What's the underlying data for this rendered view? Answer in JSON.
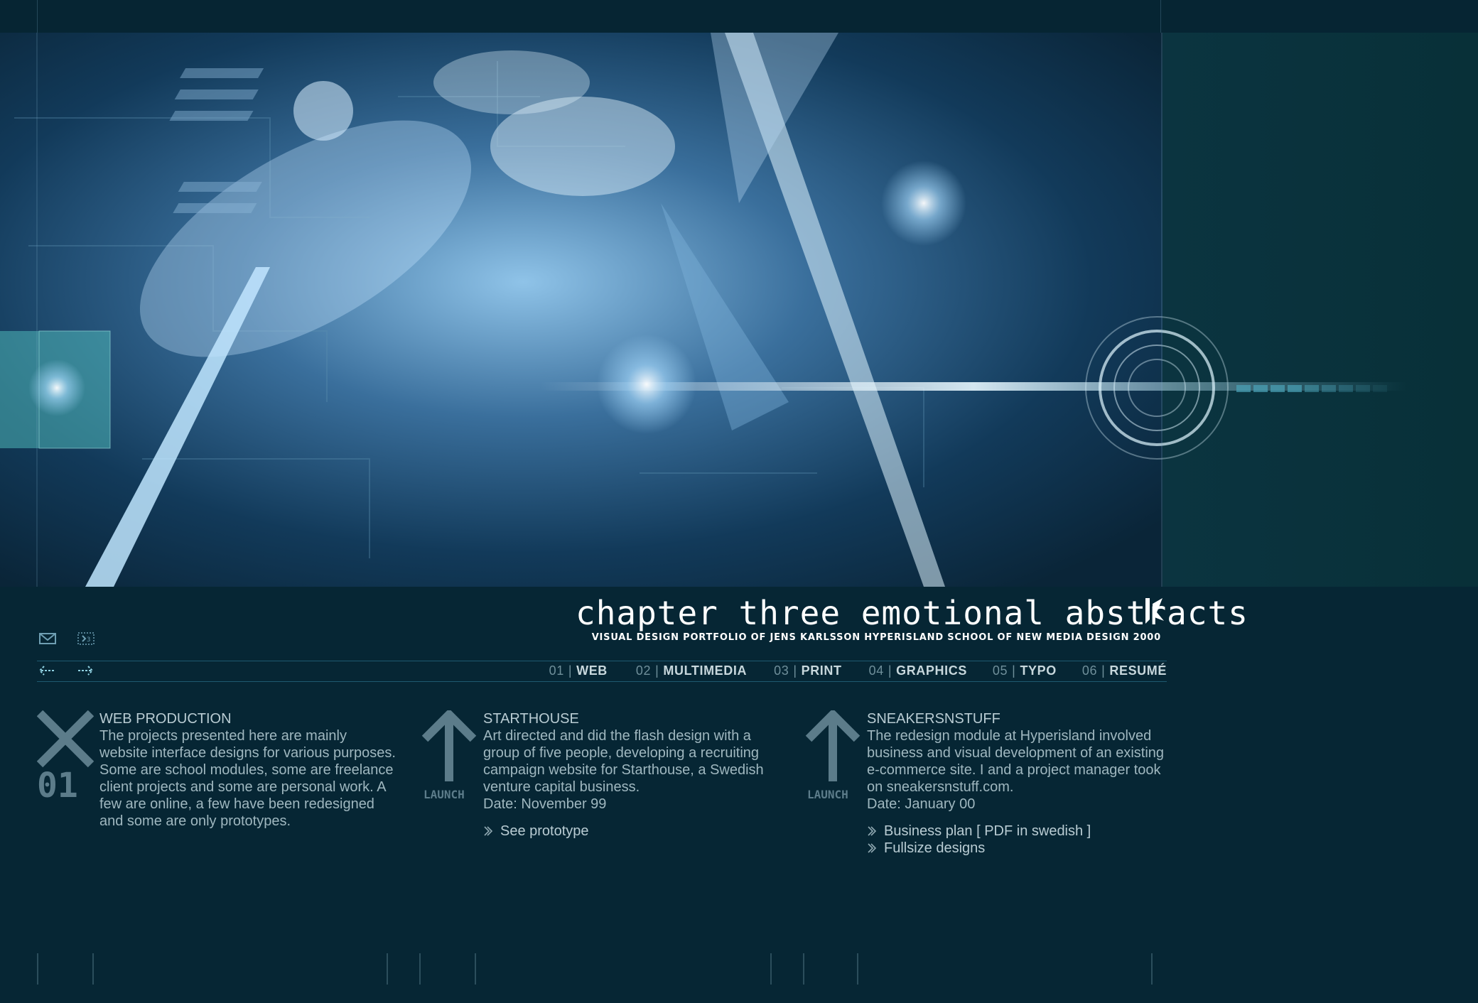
{
  "branding": {
    "chapter_title": "chapter three emotional abstracts",
    "subtitle": "VISUAL DESIGN PORTFOLIO OF JENS KARLSSON HYPERISLAND SCHOOL OF NEW MEDIA DESIGN 2000"
  },
  "icons": {
    "mail": "envelope-icon",
    "arrows_small": "forward-small-icon",
    "prev": "back-arrow-icon",
    "next": "forward-arrow-icon",
    "link_bullet": "double-chevron-icon",
    "launch": "up-arrow-launch-icon"
  },
  "nav": [
    {
      "num": "01",
      "sep": "|",
      "label": "WEB"
    },
    {
      "num": "02",
      "sep": "|",
      "label": "MULTIMEDIA"
    },
    {
      "num": "03",
      "sep": "|",
      "label": "PRINT"
    },
    {
      "num": "04",
      "sep": "|",
      "label": "GRAPHICS"
    },
    {
      "num": "05",
      "sep": "|",
      "label": "TYPO"
    },
    {
      "num": "06",
      "sep": "|",
      "label": "RESUMÉ"
    }
  ],
  "sections": {
    "web": {
      "icon_text": "01",
      "title": "WEB PRODUCTION",
      "body": "The projects presented here are mainly website interface designs for various purposes. Some are school modules, some are freelance client projects and some are personal work. A few are online, a few have been redesigned and some are only prototypes."
    },
    "starthouse": {
      "launch_label": "LAUNCH",
      "title": "STARTHOUSE",
      "body": "Art directed and did the flash design with a group of five people, developing a recruiting campaign website for Starthouse, a Swedish venture capital business.",
      "date": "Date: November 99",
      "links": [
        "See prototype"
      ]
    },
    "sneakers": {
      "launch_label": "LAUNCH",
      "title": "SNEAKERSNSTUFF",
      "body": "The redesign module at Hyperisland involved business and visual development of an existing e-commerce site. I and a project manager took on sneakersnstuff.com.",
      "date": "Date: January 00",
      "links": [
        "Business plan [ PDF in swedish ]",
        "Fullsize designs"
      ]
    }
  },
  "colors": {
    "background": "#062634",
    "accent": "#6f9fb3",
    "text": "#9fb7bf"
  }
}
